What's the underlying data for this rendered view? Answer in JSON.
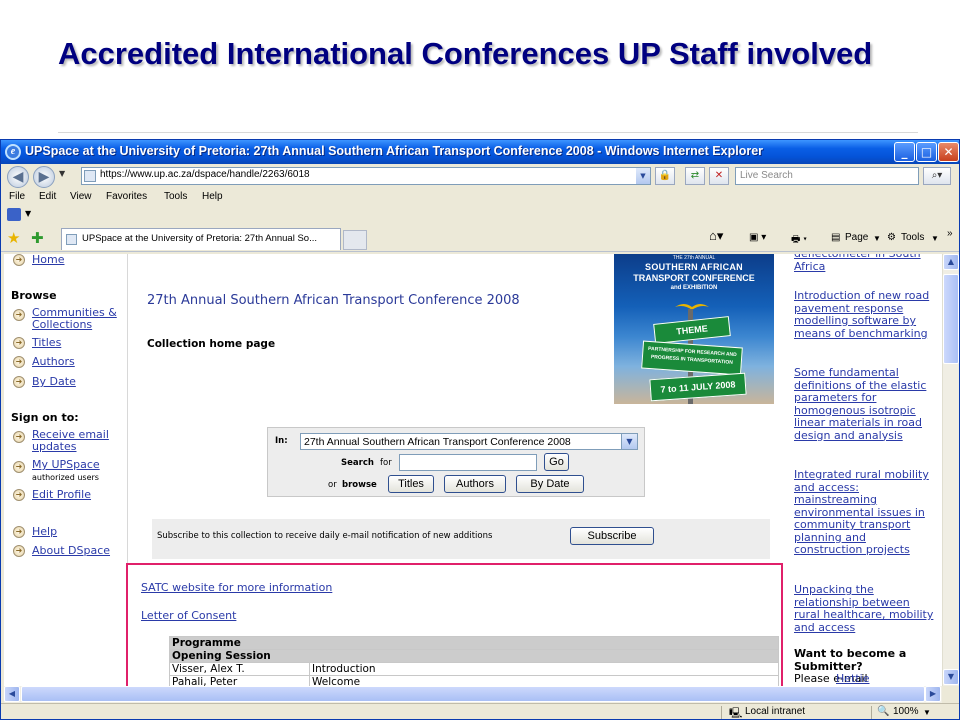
{
  "slide": {
    "title": "Accredited International Conferences UP Staff involved"
  },
  "window": {
    "title": "UPSpace at the University of Pretoria: 27th Annual Southern African Transport Conference 2008 - Windows Internet Explorer",
    "minimize": "_",
    "maximize": "□",
    "close": "✕"
  },
  "address": {
    "url": "https://www.up.ac.za/dspace/handle/2263/6018",
    "search_placeholder": "Live Search"
  },
  "menu": {
    "items": [
      "File",
      "Edit",
      "View",
      "Favorites",
      "Tools",
      "Help"
    ]
  },
  "tabs": {
    "active": "UPSpace at the University of Pretoria: 27th Annual So..."
  },
  "commands": {
    "page": "Page",
    "tools": "Tools"
  },
  "sidebar": {
    "home": "Home",
    "browse_heading": "Browse",
    "communities": "Communities & Collections",
    "titles": "Titles",
    "authors": "Authors",
    "by_date": "By Date",
    "sign_on_heading": "Sign on to:",
    "receive_email": "Receive email updates",
    "my_upspace": "My UPSpace",
    "authorized_users": "authorized users",
    "edit_profile": "Edit Profile",
    "help": "Help",
    "about": "About DSpace"
  },
  "main": {
    "collection_title": "27th Annual Southern African Transport Conference 2008",
    "collection_home": "Collection home page",
    "banner": {
      "small": "THE 27th ANNUAL",
      "line1": "SOUTHERN AFRICAN",
      "line2": "TRANSPORT CONFERENCE",
      "line3": "and EXHIBITION",
      "sign1": "THEME",
      "sign2": "PARTNERSHIP FOR RESEARCH AND PROGRESS IN TRANSPORTATION",
      "sign3": "7 to 11 JULY 2008"
    },
    "search": {
      "in_label": "In:",
      "in_value": "27th Annual Southern African Transport Conference 2008",
      "search_for": "Search",
      "for": "for",
      "go": "Go",
      "or": "or",
      "browse": "browse",
      "titles_btn": "Titles",
      "authors_btn": "Authors",
      "bydate_btn": "By Date"
    },
    "subscribe": {
      "text": "Subscribe to this collection to receive daily e-mail notification of new additions",
      "button": "Subscribe"
    },
    "links": {
      "satc": "SATC website for more information",
      "consent": "Letter of Consent"
    },
    "programme": {
      "header": "Programme",
      "session": "Opening Session",
      "rows": [
        [
          "Visser, Alex T.",
          "Introduction"
        ],
        [
          "Pahali, Peter",
          "Welcome"
        ]
      ]
    }
  },
  "right": {
    "items": [
      "deflectometer in South Africa",
      "Introduction of new road pavement response modelling software by means of benchmarking",
      "Some fundamental definitions of the elastic parameters for homogenous isotropic linear materials in road design and analysis",
      "Integrated rural mobility and access: mainstreaming environmental issues in community transport planning and construction projects",
      "Unpacking the relationship between rural healthcare, mobility and access"
    ],
    "submitter_heading": "Want to become a Submitter?",
    "submitter_text": "Please e-mail",
    "submitter_link": "Hettie"
  },
  "status": {
    "zone": "Local intranet",
    "zoom": "100%"
  }
}
